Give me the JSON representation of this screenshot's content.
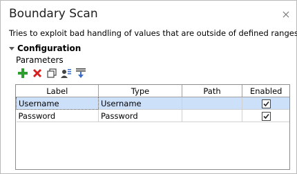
{
  "panel": {
    "title": "Boundary Scan",
    "description": "Tries to exploit bad handling of values that are outside of defined ranges.",
    "section_label": "Configuration",
    "parameters_label": "Parameters"
  },
  "toolbar": {
    "buttons": [
      {
        "icon": "add-icon",
        "color": "#2e9e2e"
      },
      {
        "icon": "delete-icon",
        "color": "#d62020"
      },
      {
        "icon": "copy-icon",
        "color": "#444444"
      },
      {
        "icon": "add-parameter-icon",
        "color": "#3b6cc4"
      },
      {
        "icon": "import-icon",
        "color": "#3b6cc4"
      }
    ]
  },
  "grid": {
    "columns": [
      "Label",
      "Type",
      "Path",
      "Enabled"
    ],
    "rows": [
      {
        "label": "Username",
        "type": "Username",
        "path": "",
        "enabled": true,
        "selected": true
      },
      {
        "label": "Password",
        "type": "Password",
        "path": "",
        "enabled": true,
        "selected": false
      }
    ]
  },
  "colors": {
    "selected_row": "#cde0fa"
  }
}
